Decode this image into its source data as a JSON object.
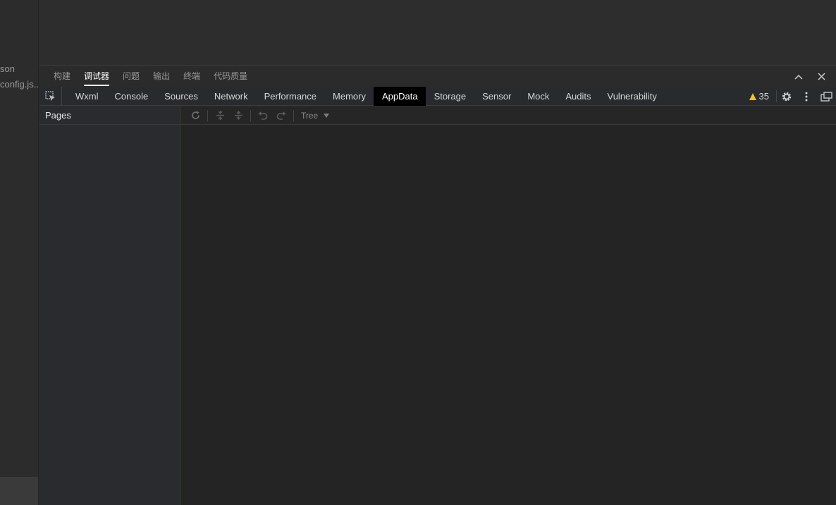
{
  "explorer": {
    "files": [
      "son",
      "config.js..."
    ]
  },
  "panel": {
    "tabs": [
      {
        "label": "构建",
        "active": false
      },
      {
        "label": "调试器",
        "active": true
      },
      {
        "label": "问题",
        "active": false
      },
      {
        "label": "输出",
        "active": false
      },
      {
        "label": "终端",
        "active": false
      },
      {
        "label": "代码质量",
        "active": false
      }
    ],
    "actions": [
      "chevron-up-icon",
      "close-icon"
    ]
  },
  "devtools": {
    "tabs": [
      {
        "label": "Wxml",
        "active": false
      },
      {
        "label": "Console",
        "active": false
      },
      {
        "label": "Sources",
        "active": false
      },
      {
        "label": "Network",
        "active": false
      },
      {
        "label": "Performance",
        "active": false
      },
      {
        "label": "Memory",
        "active": false
      },
      {
        "label": "AppData",
        "active": true
      },
      {
        "label": "Storage",
        "active": false
      },
      {
        "label": "Sensor",
        "active": false
      },
      {
        "label": "Mock",
        "active": false
      },
      {
        "label": "Audits",
        "active": false
      },
      {
        "label": "Vulnerability",
        "active": false
      }
    ],
    "warning_count": "35",
    "warning_color": "#f2c12e"
  },
  "pages_panel": {
    "title": "Pages"
  },
  "data_toolbar": {
    "view_mode": "Tree"
  },
  "colors": {
    "active_tab_bg": "#000000",
    "panel_bg": "#242424"
  }
}
